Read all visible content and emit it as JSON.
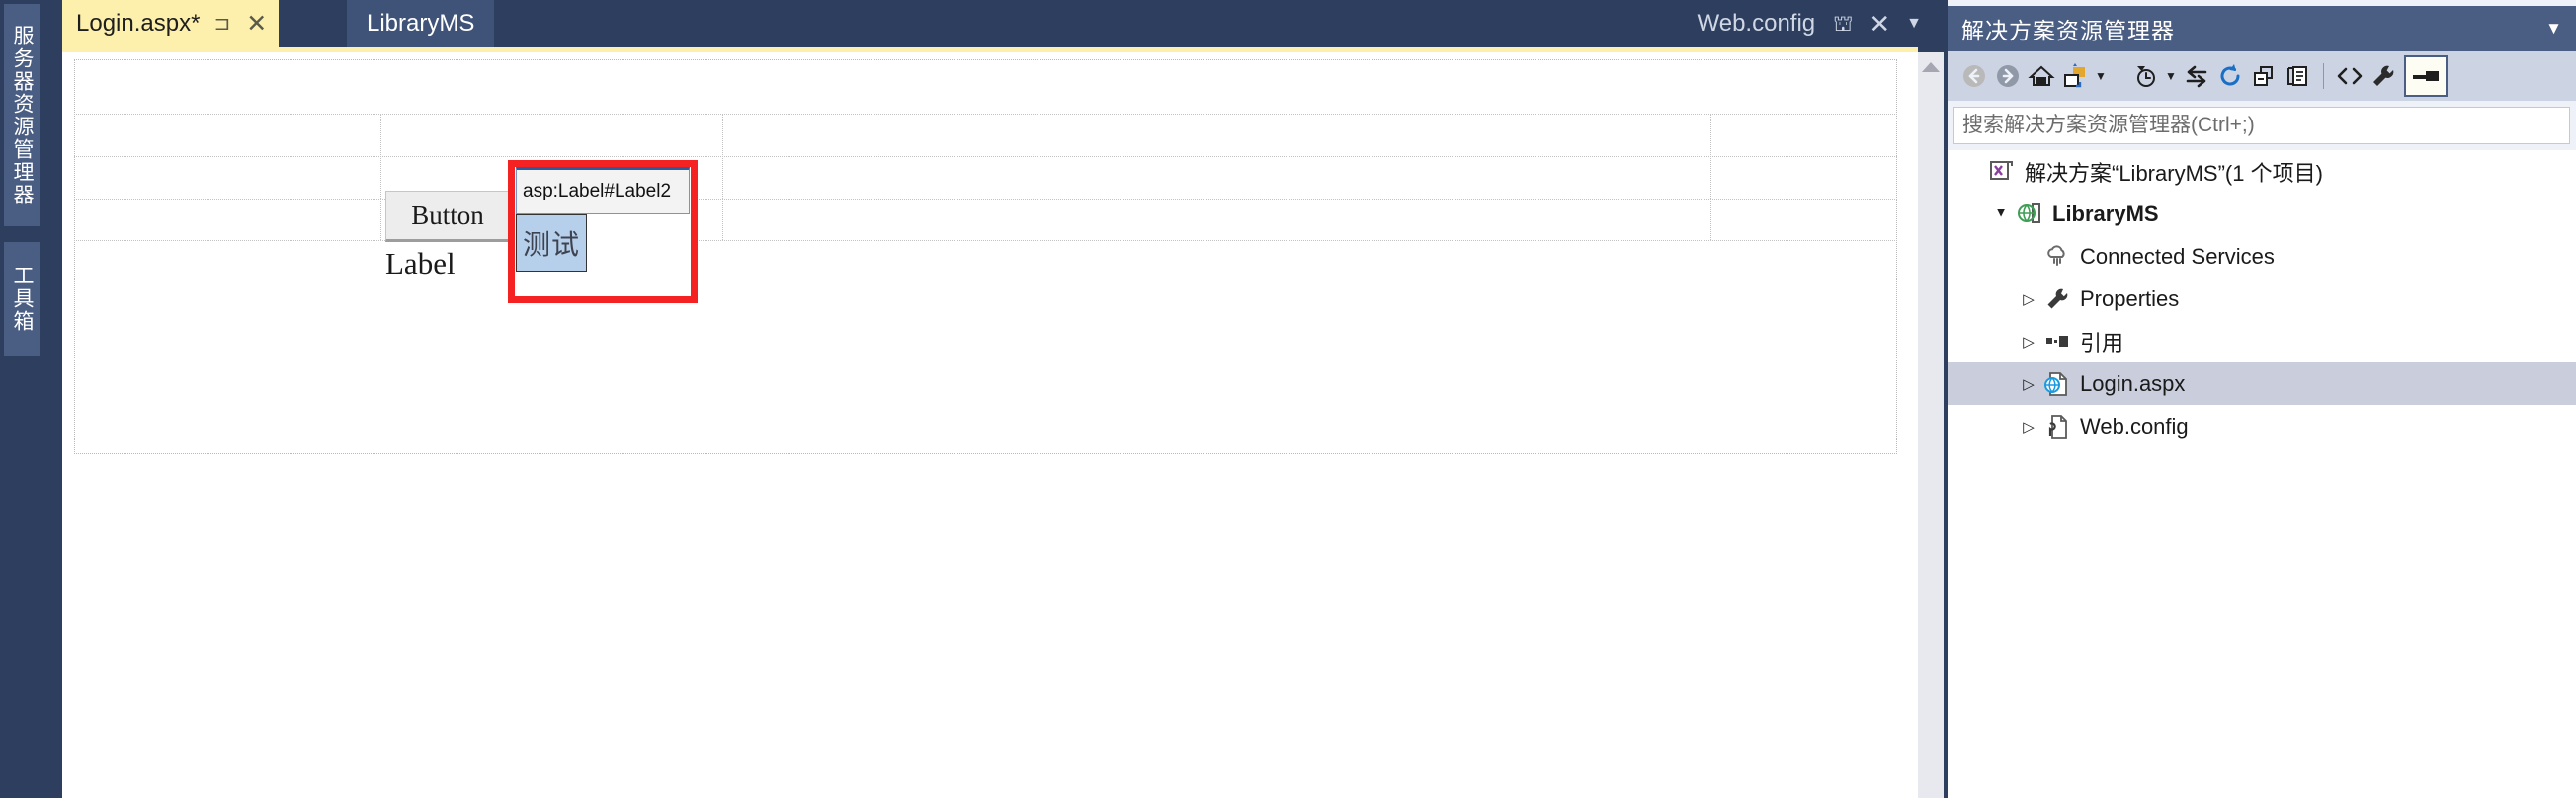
{
  "colors": {
    "chrome_dark": "#2d3e5f",
    "accent_panel": "#4a5d83",
    "active_tab_yellow": "#fdf0ac",
    "selection_red": "#f42222",
    "selection_blue": "#b6cfea",
    "tree_selection": "#c9cddc"
  },
  "left_dock": {
    "tabs": [
      {
        "label": "服务器资源管理器",
        "name": "server-explorer"
      },
      {
        "label": "工具箱",
        "name": "toolbox"
      }
    ]
  },
  "editor": {
    "tabs": [
      {
        "label": "Login.aspx*",
        "active": true,
        "pin_icon": "pin-icon",
        "close_icon": "close-icon"
      },
      {
        "label": "LibraryMS",
        "active": false
      }
    ],
    "doc_group_right": {
      "label": "Web.config",
      "restore_icon": "restore-window-icon",
      "close_icon": "close-icon",
      "chevron_icon": "chevron-down-icon"
    },
    "scrollbar": {
      "up_arrow_icon": "scroll-up-icon"
    }
  },
  "designer": {
    "button_control": {
      "text": "Button"
    },
    "label_control": {
      "text": "Label"
    },
    "smart_tag": {
      "text": "asp:Label#Label2"
    },
    "selected_label": {
      "text": "测试"
    }
  },
  "solution_explorer": {
    "title": "解决方案资源管理器",
    "title_chevron_icon": "chevron-down-icon",
    "toolbar": [
      {
        "name": "back-button",
        "icon": "back-arrow-icon"
      },
      {
        "name": "forward-button",
        "icon": "forward-arrow-icon"
      },
      {
        "name": "home-button",
        "icon": "home-icon"
      },
      {
        "name": "sync-with-active-document-button",
        "icon": "sync-folder-icon",
        "caret": true
      },
      {
        "name": "pending-changes-filter-button",
        "icon": "clock-filter-icon",
        "caret": true
      },
      {
        "name": "switch-views-button",
        "icon": "swap-arrows-icon"
      },
      {
        "name": "refresh-button",
        "icon": "refresh-icon"
      },
      {
        "name": "collapse-all-button",
        "icon": "collapse-all-icon"
      },
      {
        "name": "show-all-files-button",
        "icon": "show-all-files-icon"
      },
      {
        "name": "view-code-button",
        "icon": "angle-brackets-icon"
      },
      {
        "name": "properties-button",
        "icon": "wrench-icon"
      },
      {
        "name": "preview-selected-items-button",
        "icon": "preview-pane-icon"
      }
    ],
    "search": {
      "placeholder": "搜索解决方案资源管理器(Ctrl+;)",
      "value": ""
    },
    "tree": [
      {
        "label": "解决方案“LibraryMS”(1 个项目)",
        "icon": "solution-icon",
        "indent": 0,
        "arrow": "",
        "bold": false,
        "selected": false
      },
      {
        "label": "LibraryMS",
        "icon": "web-project-icon",
        "indent": 1,
        "arrow": "▲",
        "bold": true,
        "selected": false
      },
      {
        "label": "Connected Services",
        "icon": "connected-services-icon",
        "indent": 2,
        "arrow": "",
        "bold": false,
        "selected": false
      },
      {
        "label": "Properties",
        "icon": "wrench-icon",
        "indent": 2,
        "arrow": "▷",
        "bold": false,
        "selected": false
      },
      {
        "label": "引用",
        "icon": "references-icon",
        "indent": 2,
        "arrow": "▷",
        "bold": false,
        "selected": false
      },
      {
        "label": "Login.aspx",
        "icon": "web-form-icon",
        "indent": 2,
        "arrow": "▷",
        "bold": false,
        "selected": true
      },
      {
        "label": "Web.config",
        "icon": "config-file-icon",
        "indent": 2,
        "arrow": "▷",
        "bold": false,
        "selected": false
      }
    ]
  }
}
